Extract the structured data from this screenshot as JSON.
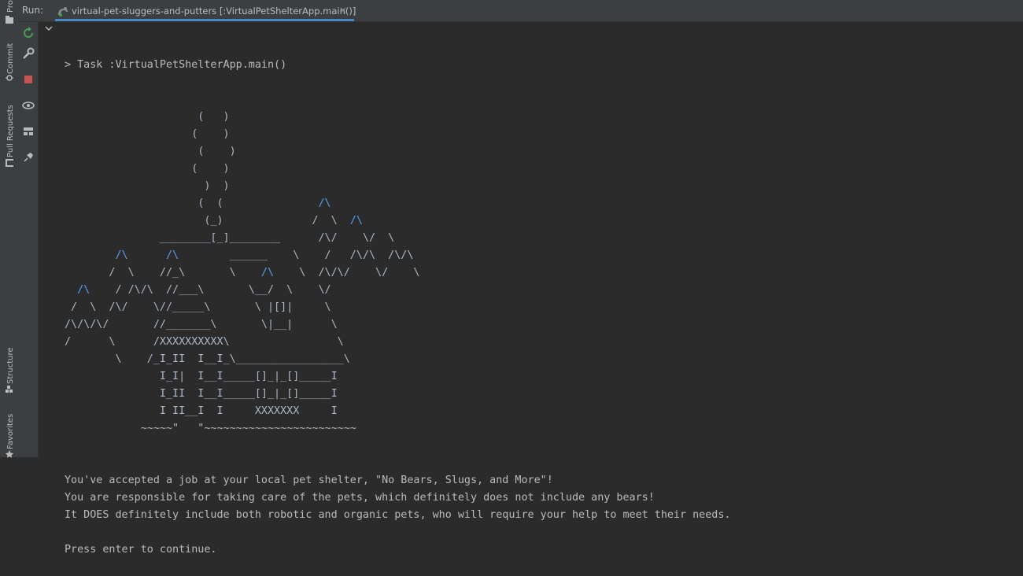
{
  "left_stripe": {
    "tabs": [
      "Pro",
      "Commit",
      "Pull Requests",
      "Structure",
      "Favorites"
    ]
  },
  "run_window": {
    "label": "Run:",
    "tab_title": "virtual-pet-sluggers-and-putters [:VirtualPetShelterApp.main()]",
    "close_glyph": "×"
  },
  "actions": [
    "rerun-icon",
    "wrench-icon",
    "stop-icon",
    "eye-icon",
    "layout-icon",
    "pin-icon"
  ],
  "console": {
    "task_line": "> Task :VirtualPetShelterApp.main()",
    "art": [
      [
        [
          "                     (   )",
          ""
        ]
      ],
      [
        [
          "                    (    )",
          ""
        ]
      ],
      [
        [
          "                     (    )",
          ""
        ]
      ],
      [
        [
          "                    (    )",
          ""
        ]
      ],
      [
        [
          "                      )  )",
          ""
        ]
      ],
      [
        [
          "                     (  (               ",
          ""
        ],
        [
          "/\\",
          "hl"
        ]
      ],
      [
        [
          "                      (_)              /  \\  ",
          ""
        ],
        [
          "/\\",
          "hl"
        ]
      ],
      [
        [
          "               ________[_]________      /\\/    \\/  \\",
          ""
        ]
      ],
      [
        [
          "        ",
          ""
        ],
        [
          "/\\",
          "hl"
        ],
        [
          "      ",
          ""
        ],
        [
          "/\\",
          "hl"
        ],
        [
          "        ______    \\    /   /\\/\\  /\\/\\",
          ""
        ]
      ],
      [
        [
          "       /  \\    //_\\       \\    ",
          ""
        ],
        [
          "/\\",
          "hl"
        ],
        [
          "    \\  /\\/\\/    \\/    \\",
          ""
        ]
      ],
      [
        [
          "  ",
          ""
        ],
        [
          "/\\",
          "hl"
        ],
        [
          "    / /\\/\\  //___\\       \\__/  \\    \\/",
          ""
        ]
      ],
      [
        [
          " /  \\  /\\/    \\//_____\\       \\ |[]|     \\",
          ""
        ]
      ],
      [
        [
          "/\\/\\/\\/       //_______\\       \\|__|      \\",
          ""
        ]
      ],
      [
        [
          "/      \\      /XXXXXXXXXX\\                 \\",
          ""
        ]
      ],
      [
        [
          "        \\    /_I_II  I__I_\\_________________\\",
          ""
        ]
      ],
      [
        [
          "               I_I|  I__I_____[]_|_[]_____I",
          ""
        ]
      ],
      [
        [
          "               I_II  I__I_____[]_|_[]_____I",
          ""
        ]
      ],
      [
        [
          "               I II__I  I     XXXXXXX     I",
          ""
        ]
      ],
      [
        [
          "            ~~~~~\"   \"~~~~~~~~~~~~~~~~~~~~~~~~",
          ""
        ]
      ]
    ],
    "messages": [
      "You've accepted a job at your local pet shelter, \"No Bears, Slugs, and More\"!",
      "You are responsible for taking care of the pets, which definitely does not include any bears!",
      "It DOES definitely include both robotic and organic pets, who will require your help to meet their needs.",
      "",
      "Press enter to continue."
    ]
  },
  "colors": {
    "background": "#2b2b2b",
    "panel": "#3c3f41",
    "text": "#bbbbbb",
    "accent": "#4a88c7",
    "highlight": "#589df6",
    "rerun": "#499c54",
    "stop": "#c75450"
  }
}
